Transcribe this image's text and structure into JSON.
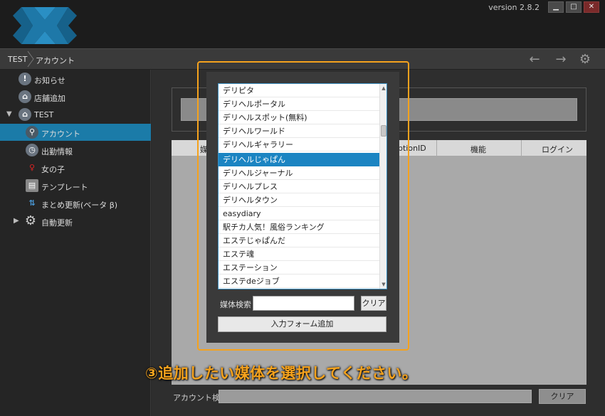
{
  "window": {
    "version": "version 2.8.2",
    "buttons": {
      "minimize": "▁",
      "maximize": "□",
      "close": "✕"
    }
  },
  "breadcrumb": {
    "items": [
      "TEST",
      "アカウント"
    ]
  },
  "toolbar": {
    "back_icon": "arrow-left-icon",
    "forward_icon": "arrow-right-icon",
    "settings_icon": "gear-icon"
  },
  "sidebar": {
    "items": [
      {
        "label": "お知らせ",
        "icon": "!",
        "icon_name": "info-icon"
      },
      {
        "label": "店舗追加",
        "icon": "⌂",
        "icon_name": "store-add-icon"
      },
      {
        "label": "TEST",
        "icon": "⌂",
        "icon_name": "store-icon"
      },
      {
        "label": "アカウント",
        "icon": "⚲",
        "icon_name": "wrench-icon"
      },
      {
        "label": "出勤情報",
        "icon": "◷",
        "icon_name": "clock-icon"
      },
      {
        "label": "女の子",
        "icon": "♀",
        "icon_name": "girl-icon"
      },
      {
        "label": "テンプレート",
        "icon": "▤",
        "icon_name": "template-icon"
      },
      {
        "label": "まとめ更新(ベータ β)",
        "icon": "⇅",
        "icon_name": "bulk-update-icon"
      },
      {
        "label": "自動更新",
        "icon": "⚙",
        "icon_name": "auto-update-gear-icon"
      }
    ]
  },
  "table": {
    "columns": [
      "媒",
      "ptionID",
      "機能",
      "ログイン"
    ]
  },
  "bottom": {
    "search_label": "アカウント検索",
    "clear_label": "クリア"
  },
  "dialog": {
    "media_list": [
      "デリピタ",
      "デリヘルポータル",
      "デリヘルスポット(無料)",
      "デリヘルワールド",
      "デリヘルギャラリー",
      "デリヘルじゃぱん",
      "デリヘルジャーナル",
      "デリヘルプレス",
      "デリヘルタウン",
      "easydiary",
      "駅チカ人気！風俗ランキング",
      "エステじゃぱんだ",
      "エステ魂",
      "エステーション",
      "エステdeジョブ"
    ],
    "selected_index": 5,
    "search_label": "媒体検索",
    "search_value": "",
    "clear_label": "クリア",
    "add_label": "入力フォーム追加"
  },
  "instruction": "③追加したい媒体を選択してください。",
  "colors": {
    "accent": "#1b84c2",
    "highlight": "#f5a21d"
  }
}
